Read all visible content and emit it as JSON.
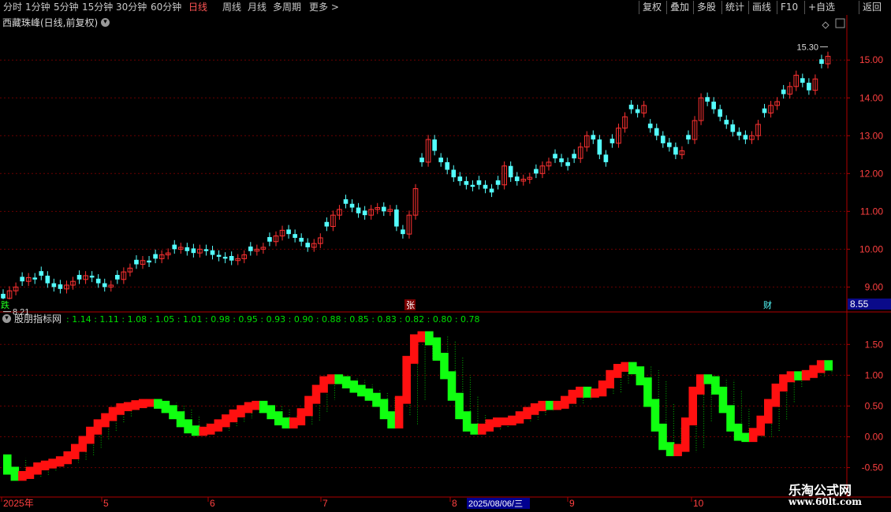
{
  "toolbar": {
    "periods": [
      "分时",
      "1分钟",
      "5分钟",
      "15分钟",
      "30分钟",
      "60分钟",
      "日线",
      "周线",
      "月线",
      "多周期",
      "更多 >"
    ],
    "active_period": "日线",
    "right_buttons": [
      "复权",
      "叠加",
      "多股",
      "统计",
      "画线",
      "F10",
      "+自选",
      "返回"
    ]
  },
  "stock": {
    "title": "西藏珠峰(日线,前复权)",
    "max_label": "15.30",
    "min_label": "8.21",
    "current_price": "8.55"
  },
  "markers": {
    "left": "跌",
    "mid": "张",
    "right": "财"
  },
  "indicator": {
    "name": "股朋指标网",
    "levels": [
      "1.14",
      "1.11",
      "1.08",
      "1.05",
      "1.01",
      "0.98",
      "0.95",
      "0.93",
      "0.90",
      "0.88",
      "0.85",
      "0.83",
      "0.82",
      "0.80",
      "0.78"
    ],
    "y_ticks": [
      "1.50",
      "1.00",
      "0.50",
      "0.00",
      "-0.50"
    ]
  },
  "price_axis": {
    "ticks": [
      "15.00",
      "14.00",
      "13.00",
      "12.00",
      "11.00",
      "10.00",
      "9.00"
    ]
  },
  "date_axis": {
    "labels": [
      "2025年",
      "5",
      "6",
      "7",
      "8",
      "9",
      "10"
    ],
    "cursor_label": "2025/08/06/三"
  },
  "watermark": {
    "name": "乐淘公式网",
    "url": "www.60lt.com"
  },
  "chart_data": [
    {
      "type": "candlestick",
      "title": "西藏珠峰(日线,前复权)",
      "ylim": [
        8.55,
        15.9
      ],
      "close_series": [
        8.7,
        8.9,
        9.0,
        9.15,
        9.25,
        9.2,
        9.3,
        9.1,
        9.0,
        8.95,
        9.05,
        9.15,
        9.2,
        9.3,
        9.25,
        9.1,
        9.0,
        9.05,
        9.2,
        9.4,
        9.5,
        9.6,
        9.7,
        9.65,
        9.75,
        9.85,
        9.9,
        10.0,
        10.05,
        9.95,
        9.9,
        10.0,
        9.95,
        9.85,
        9.8,
        9.75,
        9.7,
        9.75,
        9.85,
        9.95,
        10.0,
        10.05,
        10.2,
        10.35,
        10.5,
        10.4,
        10.3,
        10.2,
        10.05,
        10.15,
        10.3,
        10.6,
        10.9,
        11.05,
        11.2,
        11.1,
        10.95,
        10.9,
        11.05,
        11.1,
        11.0,
        11.05,
        10.6,
        10.4,
        10.9,
        11.6,
        12.3,
        12.9,
        12.6,
        12.3,
        12.1,
        11.9,
        11.8,
        11.7,
        11.65,
        11.7,
        11.6,
        11.5,
        11.7,
        12.2,
        11.9,
        11.8,
        11.85,
        11.9,
        12.0,
        12.2,
        12.3,
        12.4,
        12.3,
        12.2,
        12.4,
        12.7,
        13.0,
        12.9,
        12.5,
        12.3,
        12.8,
        13.2,
        13.5,
        13.7,
        13.6,
        13.8,
        13.2,
        13.0,
        12.8,
        12.7,
        12.5,
        12.6,
        12.9,
        13.4,
        14.0,
        13.9,
        13.7,
        13.5,
        13.3,
        13.1,
        13.0,
        12.9,
        13.0,
        13.3,
        13.6,
        13.8,
        13.9,
        14.1,
        14.3,
        14.6,
        14.4,
        14.2,
        14.5,
        14.9,
        15.1
      ],
      "points": [
        {
          "date": "2025-04",
          "close": 8.7
        },
        {
          "date": "2025-06",
          "close": 10.0
        },
        {
          "date": "2025-07",
          "close": 11.0
        },
        {
          "date": "2025-08",
          "close": 12.7
        },
        {
          "date": "2025-09",
          "close": 13.5
        },
        {
          "date": "2025-10",
          "close": 13.0
        },
        {
          "date": "2025-11",
          "close": 15.1
        }
      ]
    },
    {
      "type": "line",
      "title": "股朋指标网",
      "ylim": [
        -0.85,
        1.9
      ],
      "series": [
        {
          "values": [
            -0.35,
            -0.55,
            -0.65,
            -0.62,
            -0.55,
            -0.48,
            -0.45,
            -0.42,
            -0.38,
            -0.3,
            -0.18,
            -0.05,
            0.1,
            0.22,
            0.32,
            0.42,
            0.48,
            0.5,
            0.53,
            0.55,
            0.55,
            0.52,
            0.45,
            0.35,
            0.22,
            0.12,
            0.08,
            0.1,
            0.15,
            0.22,
            0.3,
            0.38,
            0.45,
            0.5,
            0.52,
            0.45,
            0.35,
            0.25,
            0.2,
            0.25,
            0.4,
            0.6,
            0.78,
            0.92,
            0.95,
            0.92,
            0.85,
            0.78,
            0.72,
            0.65,
            0.55,
            0.35,
            0.2,
            0.6,
            1.25,
            1.6,
            1.65,
            1.55,
            1.3,
            1.0,
            0.65,
            0.35,
            0.15,
            0.1,
            0.15,
            0.22,
            0.25,
            0.25,
            0.28,
            0.35,
            0.42,
            0.48,
            0.52,
            0.5,
            0.52,
            0.6,
            0.7,
            0.75,
            0.7,
            0.72,
            0.85,
            1.02,
            1.12,
            1.15,
            1.08,
            0.9,
            0.55,
            0.15,
            -0.15,
            -0.25,
            -0.18,
            0.25,
            0.75,
            0.95,
            0.92,
            0.75,
            0.45,
            0.15,
            0.0,
            -0.02,
            0.08,
            0.28,
            0.55,
            0.8,
            0.95,
            1.0,
            0.98,
            1.02,
            1.1,
            1.18,
            1.14
          ]
        }
      ],
      "y_ticks": [
        1.5,
        1.0,
        0.5,
        0.0,
        -0.5
      ]
    }
  ]
}
